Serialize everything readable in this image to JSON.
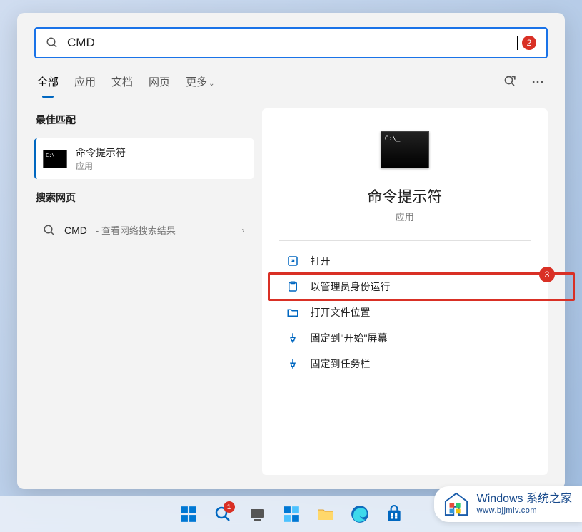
{
  "search": {
    "query": "CMD",
    "badge": "2"
  },
  "tabs": {
    "all": "全部",
    "apps": "应用",
    "docs": "文档",
    "web": "网页",
    "more": "更多"
  },
  "sections": {
    "best_match": "最佳匹配",
    "search_web": "搜索网页"
  },
  "best_match": {
    "title": "命令提示符",
    "subtitle": "应用"
  },
  "web_result": {
    "query": "CMD",
    "suffix": " - 查看网络搜索结果"
  },
  "detail": {
    "name": "命令提示符",
    "type": "应用"
  },
  "actions": {
    "open": "打开",
    "run_admin": "以管理员身份运行",
    "open_location": "打开文件位置",
    "pin_start": "固定到\"开始\"屏幕",
    "pin_taskbar": "固定到任务栏"
  },
  "callouts": {
    "search_badge": "2",
    "admin_badge": "3",
    "taskbar_search_badge": "1"
  },
  "watermark": {
    "title": "Windows 系统之家",
    "url": "www.bjjmlv.com"
  }
}
